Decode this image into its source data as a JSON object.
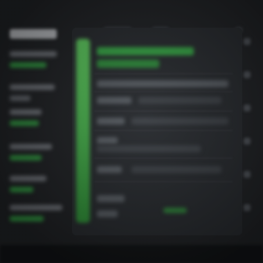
{
  "colors": {
    "background": "#1f2124",
    "panel": "#26292d",
    "accent_green": "#35a844",
    "muted_text": "#585d63"
  },
  "note_text": ""
}
